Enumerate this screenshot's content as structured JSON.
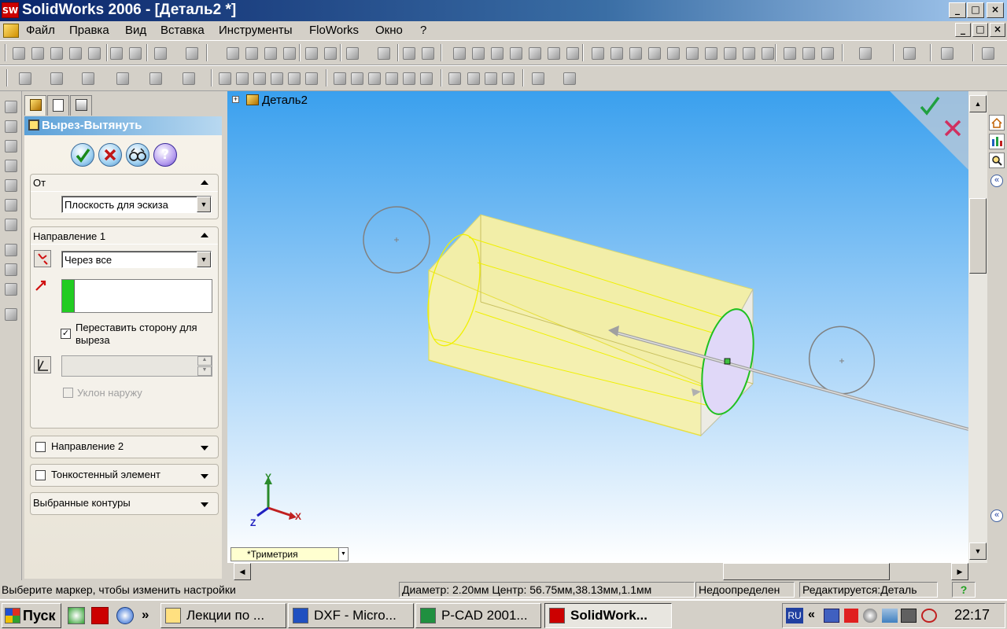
{
  "window": {
    "title": "SolidWorks 2006 - [Деталь2 *]",
    "logo": "SW",
    "min": "_",
    "max": "□",
    "close": "×"
  },
  "menu": [
    "Файл",
    "Правка",
    "Вид",
    "Вставка",
    "Инструменты",
    "FloWorks",
    "Окно",
    "?"
  ],
  "pm": {
    "title": "Вырез-Вытянуть",
    "from": {
      "label": "От",
      "value": "Плоскость для эскиза"
    },
    "dir1": {
      "label": "Направление 1",
      "end": "Через все",
      "flip_label": "Переставить сторону для выреза",
      "flip_checked": "✓",
      "draft_label": "Уклон наружу"
    },
    "dir2": {
      "label": "Направление 2"
    },
    "thin": {
      "label": "Тонкостенный элемент"
    },
    "contours": {
      "label": "Выбранные контуры"
    }
  },
  "tree": {
    "root": "Деталь2",
    "expand": "+"
  },
  "triad": {
    "x": "X",
    "y": "Y",
    "z": "Z"
  },
  "view": {
    "orientation": "*Триметрия"
  },
  "status": {
    "hint": "Выберите маркер, чтобы изменить настройки",
    "measure": "Диаметр: 2.20мм  Центр: 56.75мм,38.13мм,1.1мм",
    "state": "Недоопределен",
    "editing": "Редактируется:Деталь",
    "help": "?"
  },
  "taskbar": {
    "start": "Пуск",
    "more": "»",
    "items": [
      "Лекции по ...",
      "DXF - Micro...",
      "P-CAD 2001...",
      "SolidWork..."
    ],
    "lang": "RU",
    "tray_more": "«",
    "clock": "22:17"
  },
  "colors": {
    "accept": "#2e9e2e",
    "cancel": "#c01818",
    "titlebar": "#0a246a",
    "sketch": "#f0f000",
    "model_face": "#f4f0b0"
  }
}
